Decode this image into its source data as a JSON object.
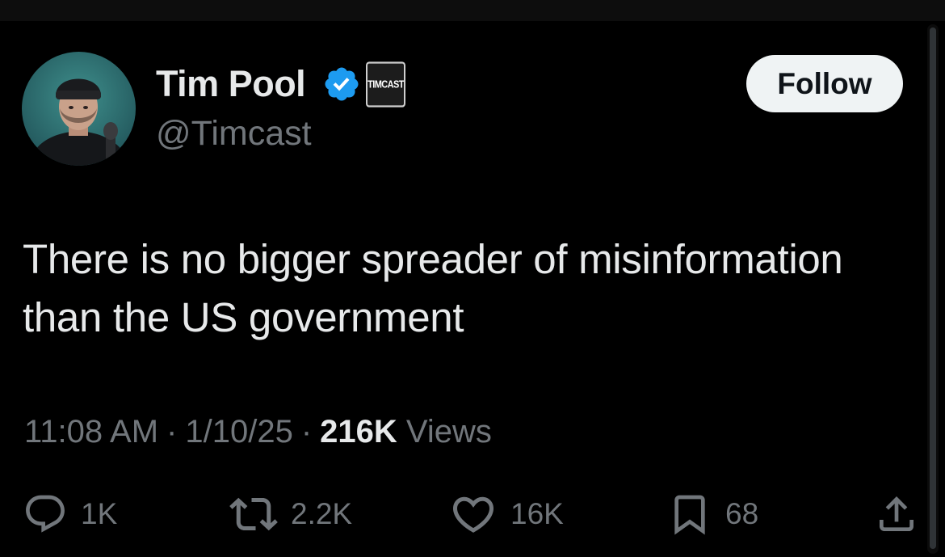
{
  "tweet": {
    "author": {
      "display_name": "Tim Pool",
      "handle": "@Timcast",
      "verified": true,
      "affiliate_badge_text": "TIMCAST"
    },
    "follow_label": "Follow",
    "text": "There is no bigger spreader of misinformation than the US government",
    "meta": {
      "time": "11:08 AM",
      "date": "1/10/25",
      "separator": "·",
      "views_count": "216K",
      "views_label": "Views"
    },
    "actions": {
      "replies": "1K",
      "reposts": "2.2K",
      "likes": "16K",
      "bookmarks": "68"
    }
  },
  "icons": {
    "verified": "verified-badge-icon",
    "reply": "reply-icon",
    "repost": "repost-icon",
    "like": "heart-icon",
    "bookmark": "bookmark-icon",
    "share": "share-icon"
  },
  "colors": {
    "background": "#000000",
    "text_primary": "#e7e9ea",
    "text_secondary": "#71767b",
    "verified_blue": "#1d9bf0",
    "follow_bg": "#eff3f4",
    "follow_text": "#0f1419"
  }
}
